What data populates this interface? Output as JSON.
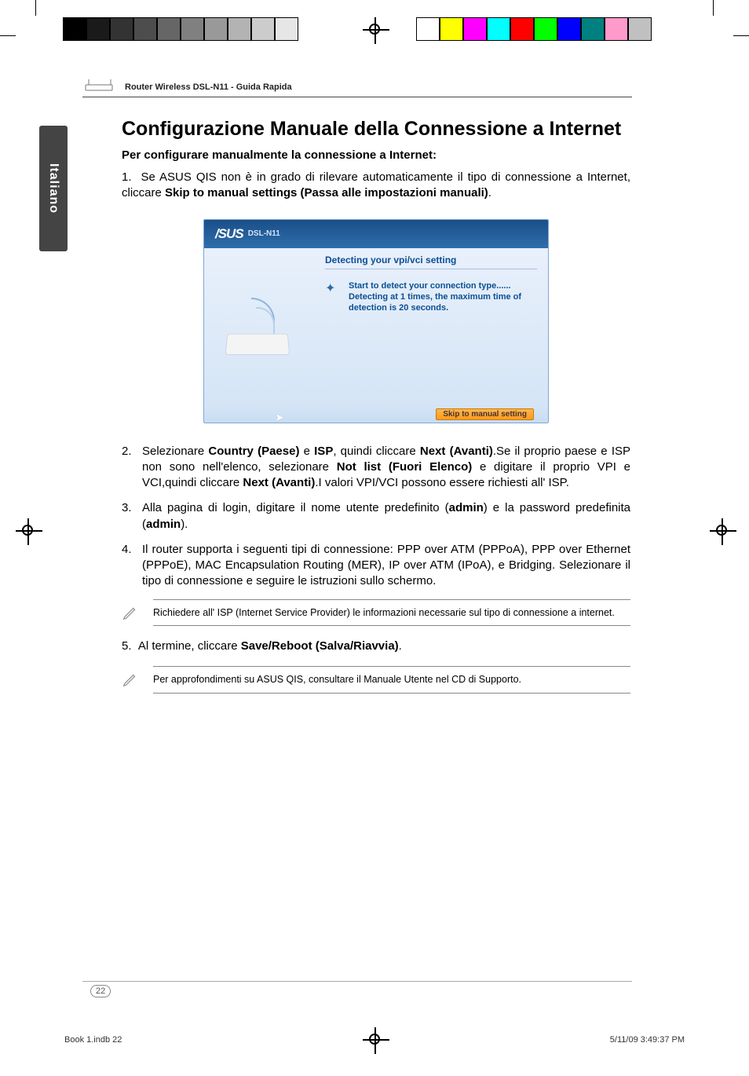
{
  "print_marks": {
    "colors_left": [
      "#000000",
      "#1a1a1a",
      "#333333",
      "#4d4d4d",
      "#666666",
      "#808080",
      "#999999",
      "#b3b3b3",
      "#cccccc",
      "#e6e6e6"
    ],
    "colors_right": [
      "#ffffff",
      "#ffff00",
      "#ff00ff",
      "#00ffff",
      "#ff0000",
      "#00ff00",
      "#0000ff",
      "#008080",
      "#ff9acb",
      "#c0c0c0"
    ]
  },
  "header": {
    "running_title": "Router Wireless DSL-N11 - Guida Rapida"
  },
  "side_tab": "Italiano",
  "title": "Configurazione Manuale della Connessione a Internet",
  "subtitle": "Per configurare manualmente la connessione a Internet:",
  "step1": {
    "num": "1.",
    "pre": "Se ASUS QIS non è in grado di rilevare automaticamente il tipo di connessione a Internet, cliccare ",
    "bold": "Skip to manual settings (Passa alle impostazioni manuali)",
    "post": "."
  },
  "qis": {
    "brand": "/SUS",
    "model": "DSL-N11",
    "heading": "Detecting your vpi/vci setting",
    "line1": "Start to detect your connection type......",
    "line2": "Detecting at 1 times, the maximum time of",
    "line3": "detection is 20 seconds.",
    "skip_button": "Skip to manual setting"
  },
  "steps": [
    {
      "parts": [
        {
          "t": "Selezionare "
        },
        {
          "t": "Country (Paese)",
          "b": true
        },
        {
          "t": " e "
        },
        {
          "t": "ISP",
          "b": true
        },
        {
          "t": ", quindi cliccare "
        },
        {
          "t": "Next (Avanti)",
          "b": true
        },
        {
          "t": ".Se il proprio paese e ISP non sono nell'elenco, selezionare "
        },
        {
          "t": "Not list (Fuori Elenco)",
          "b": true
        },
        {
          "t": " e digitare il proprio VPI e VCI,quindi cliccare "
        },
        {
          "t": "Next (Avanti)",
          "b": true
        },
        {
          "t": ".I valori VPI/VCI possono essere richiesti all' ISP."
        }
      ]
    },
    {
      "parts": [
        {
          "t": "Alla pagina di login, digitare il nome utente predefinito ("
        },
        {
          "t": "admin",
          "b": true
        },
        {
          "t": ") e la password predefinita ("
        },
        {
          "t": "admin",
          "b": true
        },
        {
          "t": ")."
        }
      ]
    },
    {
      "parts": [
        {
          "t": "Il router supporta i seguenti tipi di connessione: PPP over ATM (PPPoA), PPP over Ethernet (PPPoE), MAC Encapsulation Routing (MER), IP over ATM (IPoA), e Bridging. Selezionare il tipo di connessione e seguire le istruzioni sullo schermo."
        }
      ]
    }
  ],
  "note1": "Richiedere all' ISP (Internet Service Provider) le informazioni necessarie sul tipo di connessione a internet.",
  "step5": {
    "num": "5.",
    "pre": "Al termine, cliccare ",
    "bold": "Save/Reboot (Salva/Riavvia)",
    "post": "."
  },
  "note2": "Per approfondimenti su ASUS QIS, consultare il Manuale Utente nel CD di Supporto.",
  "page_number": "22",
  "footer_left": "Book 1.indb   22",
  "footer_right": "5/11/09   3:49:37 PM"
}
